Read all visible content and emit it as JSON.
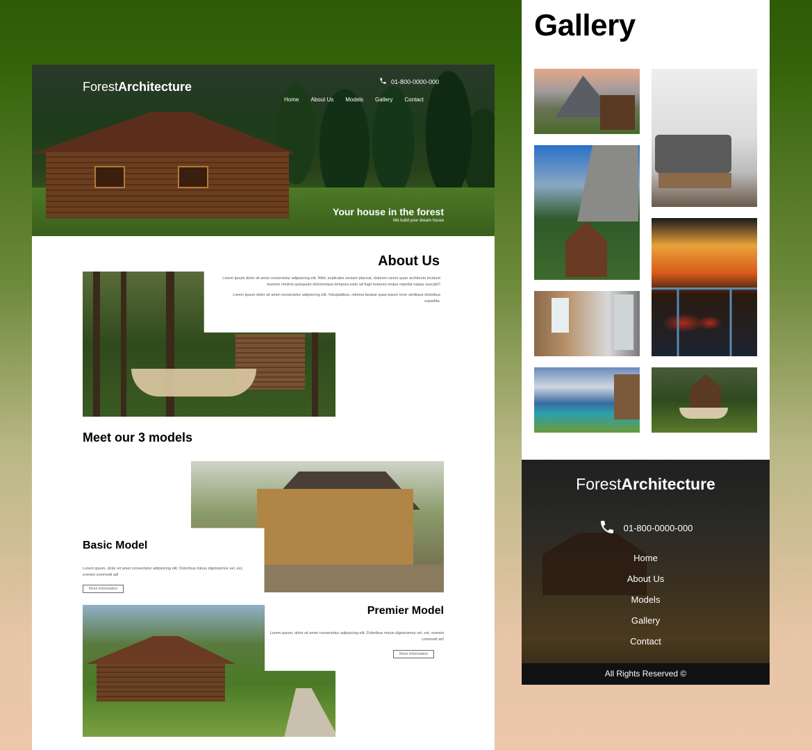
{
  "mockup": {
    "logo_light": "Forest",
    "logo_bold": "Architecture",
    "phone": "01-800-0000-000",
    "nav": [
      "Home",
      "About Us",
      "Models",
      "Gallery",
      "Contact"
    ],
    "hero_title": "Your house in the forest",
    "hero_subtitle": "We build your dream house",
    "about": {
      "title": "About Us",
      "paragraph1": "Lorem ipsum dolor sit amet consectetur adipisicing elit. Nihil, explicabo veniam placeat, dolorem nemo quae architecto incidunt maxime minima quisquam doloremque tempora iusto ad fugit maiores neque repellat eaque suscipit?",
      "paragraph2": "Lorem ipsum dolor sit amet consectetur adipisicing elit. Voluptatibus, minima beatae quas ipsum error similique doloribus expedita."
    },
    "models_title": "Meet our 3 models",
    "basic": {
      "title": "Basic Model",
      "text": "Lorem ipsum, dolor sit amet consectetur adipisicing elit. Doloribus minus dignissimos vel, est, eveniet commodi ad!",
      "button": "More information"
    },
    "premier": {
      "title": "Premier Model",
      "text": "Lorem ipsum, dolor sit amet consectetur adipisicing elit. Doloribus minus dignissimos vel, est, eveniet commodi ad!",
      "button": "More information"
    }
  },
  "gallery": {
    "title": "Gallery"
  },
  "footer": {
    "logo_light": "Forest",
    "logo_bold": "Architecture",
    "phone": "01-800-0000-000",
    "links": [
      "Home",
      "About Us",
      "Models",
      "Gallery",
      "Contact"
    ],
    "copyright": "All Rights Reserved ©"
  },
  "colors": {
    "bg_top": "#2f5a07",
    "bg_bottom": "#edc7aa",
    "text_dark": "#000000",
    "footer_bar": "#111111"
  },
  "icons": [
    "phone-icon"
  ]
}
